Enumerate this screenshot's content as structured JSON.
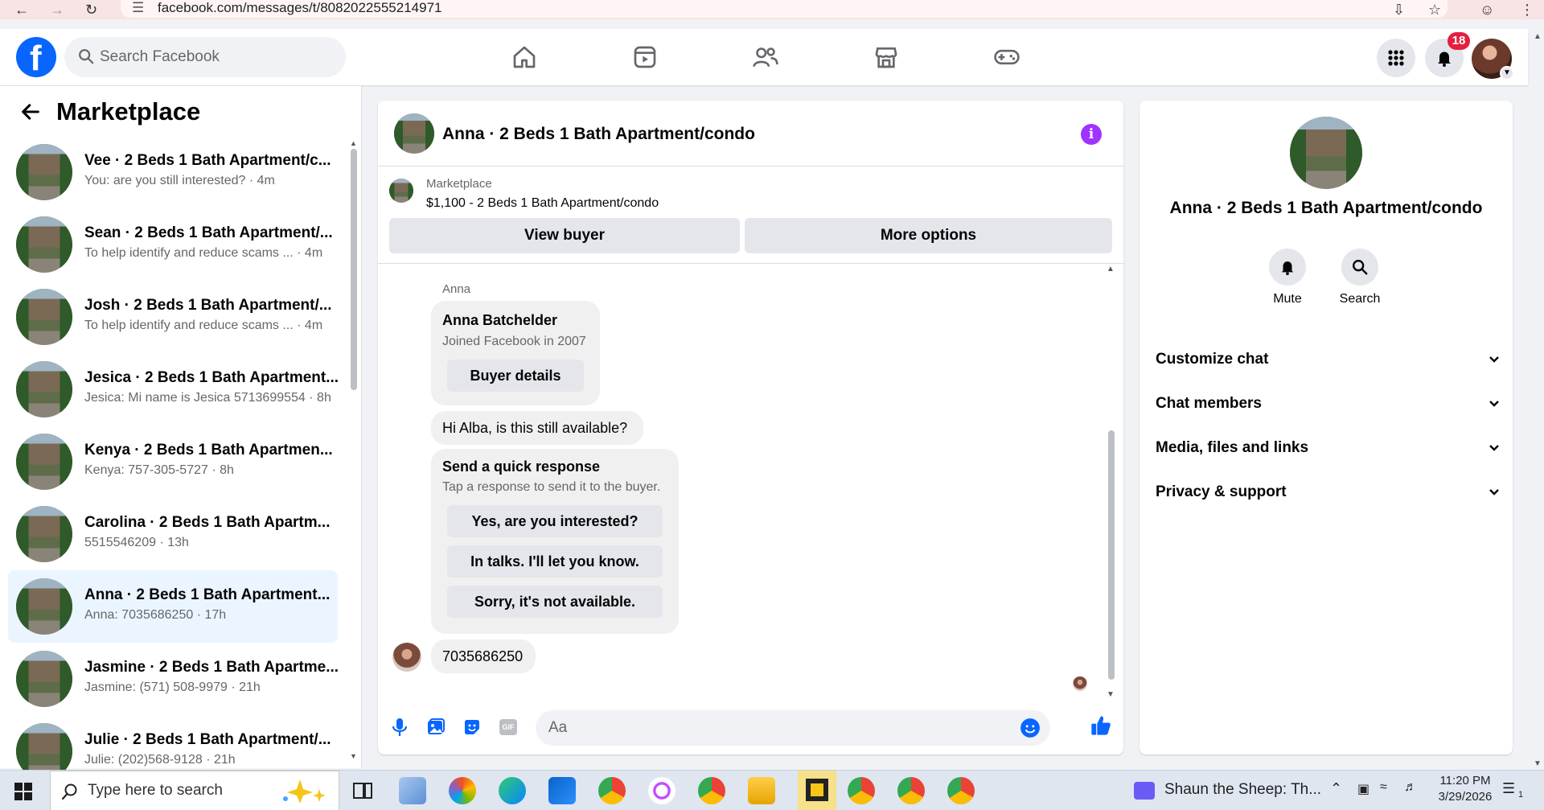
{
  "browser": {
    "url": "facebook.com/messages/t/8082022555214971"
  },
  "header": {
    "search_placeholder": "Search Facebook",
    "notification_count": "18"
  },
  "sidebar": {
    "title": "Marketplace",
    "conversations": [
      {
        "name": "Vee · 2 Beds 1 Bath Apartment/c...",
        "preview": "You: are you still interested? · 4m"
      },
      {
        "name": "Sean · 2 Beds 1 Bath Apartment/...",
        "preview": "To help identify and reduce scams ... · 4m"
      },
      {
        "name": "Josh · 2 Beds 1 Bath Apartment/...",
        "preview": "To help identify and reduce scams ... · 4m"
      },
      {
        "name": "Jesica · 2 Beds 1 Bath Apartment...",
        "preview": "Jesica: Mi name is Jesica 5713699554 · 8h"
      },
      {
        "name": "Kenya · 2 Beds 1 Bath Apartmen...",
        "preview": "Kenya: 757-305-5727 · 8h"
      },
      {
        "name": "Carolina · 2 Beds 1 Bath Apartm...",
        "preview": "5515546209 · 13h"
      },
      {
        "name": "Anna · 2 Beds 1 Bath Apartment...",
        "preview": "Anna: 7035686250 · 17h"
      },
      {
        "name": "Jasmine · 2 Beds 1 Bath Apartme...",
        "preview": "Jasmine: (571) 508-9979 · 21h"
      },
      {
        "name": "Julie · 2 Beds 1 Bath Apartment/...",
        "preview": "Julie: (202)568-9128 · 21h"
      }
    ]
  },
  "chat": {
    "title": "Anna · 2 Beds 1 Bath Apartment/condo",
    "listing": {
      "source": "Marketplace",
      "price_line": "$1,100 - 2 Beds 1 Bath Apartment/condo",
      "view_buyer": "View buyer",
      "more_options": "More options"
    },
    "messages": {
      "sender": "Anna",
      "profile_name": "Anna Batchelder",
      "profile_joined": "Joined Facebook in 2007",
      "buyer_details": "Buyer details",
      "first_message": "Hi Alba, is this still available?",
      "quick_title": "Send a quick response",
      "quick_sub": "Tap a response to send it to the buyer.",
      "quick_1": "Yes, are you interested?",
      "quick_2": "In talks. I'll let you know.",
      "quick_3": "Sorry, it's not available.",
      "last_message": "7035686250"
    },
    "composer_placeholder": "Aa"
  },
  "right_panel": {
    "title": "Anna · 2 Beds 1 Bath Apartment/condo",
    "mute": "Mute",
    "search": "Search",
    "sections": [
      "Customize chat",
      "Chat members",
      "Media, files and links",
      "Privacy & support"
    ]
  },
  "taskbar": {
    "search_placeholder": "Type here to search",
    "media_title": "Shaun the Sheep: Th...",
    "time": "11:20 PM",
    "date": "3/29/2026",
    "notif_count": "1"
  }
}
